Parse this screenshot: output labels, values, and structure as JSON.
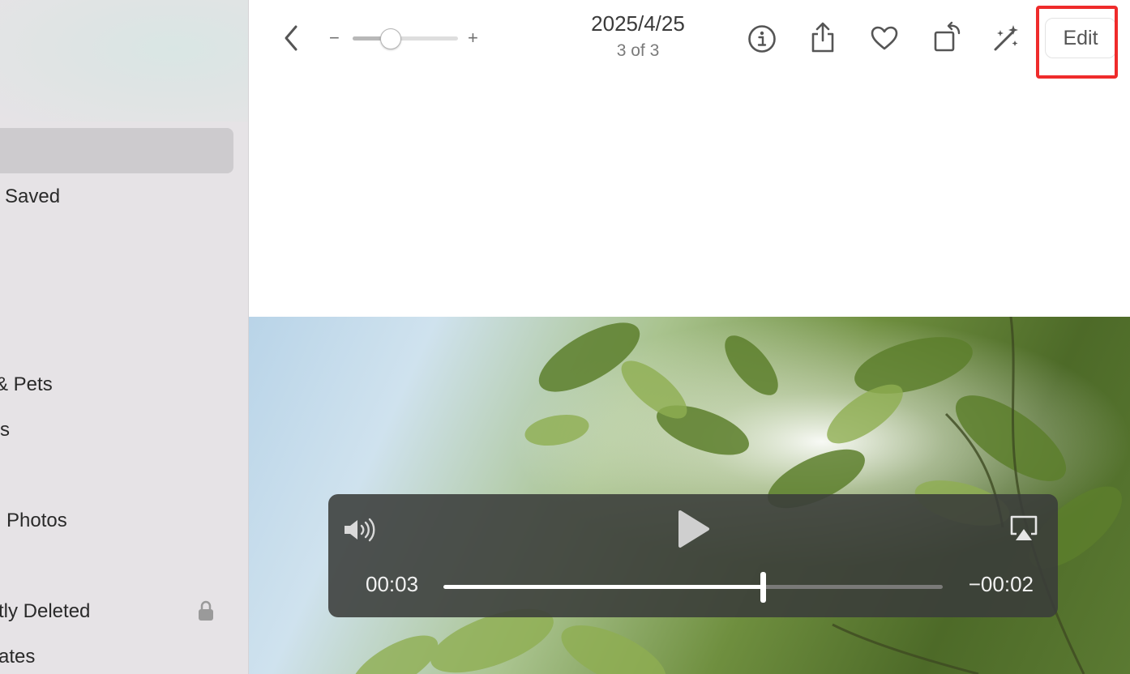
{
  "sidebar": {
    "items": [
      {
        "label": "Saved"
      },
      {
        "label": "& Pets"
      },
      {
        "label": "s"
      },
      {
        "label": "Photos"
      },
      {
        "label": "tly Deleted"
      },
      {
        "label": "ates"
      }
    ]
  },
  "toolbar": {
    "date": "2025/4/25",
    "count": "3 of 3",
    "zoom_minus": "−",
    "zoom_plus": "+",
    "zoom_level": 0.35,
    "edit_label": "Edit"
  },
  "video": {
    "current_time": "00:03",
    "remaining_time": "−00:02",
    "progress": 0.64
  },
  "icons": [
    "back-icon",
    "info-icon",
    "share-icon",
    "favorite-icon",
    "rotate-icon",
    "enhance-icon",
    "volume-icon",
    "play-icon",
    "airplay-icon",
    "lock-icon"
  ],
  "colors": {
    "highlight": "#ef2b2b",
    "sidebar_bg": "#e6e3e6",
    "sidebar_selected": "#cdcbce"
  }
}
